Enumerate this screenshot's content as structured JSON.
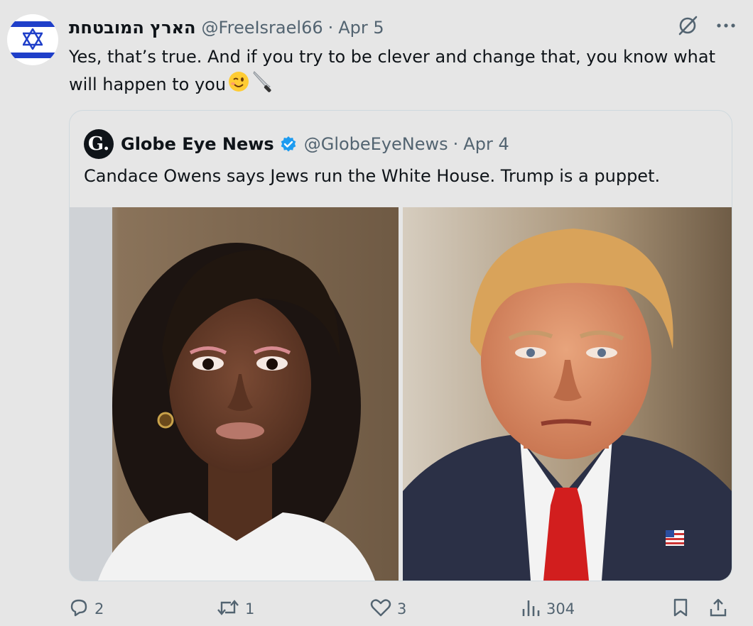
{
  "tweet": {
    "author_name": "הארץ המובטחת",
    "handle": "@FreeIsrael66",
    "separator": "·",
    "date": "Apr 5",
    "text": "Yes, that’s true. And if you try to be clever and change that, you know what will happen to you",
    "text_emojis": [
      "winking-face",
      "knife"
    ]
  },
  "quote": {
    "logo_letter": "G.",
    "author_name": "Globe Eye News",
    "verified": true,
    "handle": "@GlobeEyeNews",
    "separator": "·",
    "date": "Apr 4",
    "text": "Candace Owens says Jews run the White House. Trump is a puppet.",
    "photos": [
      "portrait-woman",
      "portrait-man-red-tie"
    ]
  },
  "actions": {
    "replies": "2",
    "reposts": "1",
    "likes": "3",
    "views": "304"
  },
  "colors": {
    "background": "#e6e6e6",
    "text": "#0f1419",
    "secondary": "#536471",
    "verified": "#1d9bf0",
    "flag_blue": "#1f3fc9"
  }
}
